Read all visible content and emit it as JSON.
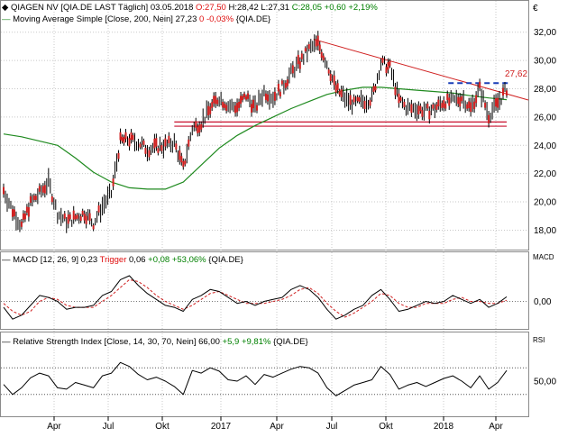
{
  "colors": {
    "price": "#000000",
    "sma": "#1f8a1f",
    "macd": "#000000",
    "trigger": "#d02020",
    "rsi": "#000000",
    "trend_red": "#d02020",
    "support_red": "#c8102e",
    "resistance_blue": "#1a3fb8",
    "grid": "#c8c8c8",
    "text_red": "#e01010",
    "text_green": "#008000",
    "annotation": "#d02020"
  },
  "chart_data": [
    {
      "type": "line",
      "panel": "price",
      "currency_symbol": "€",
      "header": {
        "name": "QIAGEN NV [QIA.DE LAST Täglich]",
        "date": "03.05.2018",
        "open": "O:27,50",
        "high": "H:28,42",
        "low": "L:27,31",
        "close": "C:28,05",
        "change": "+0,60",
        "change_pct": "+2,19%"
      },
      "sma_header": {
        "name": "Moving Average Simple [Close, 200, Nein]",
        "value": "27,23",
        "change": "0",
        "change_pct": "-0,03%",
        "symbol": "{QIA.DE}"
      },
      "annotation": "27,62",
      "ylim": [
        17.2,
        33.0
      ],
      "y_ticks": [
        "18,00",
        "20,00",
        "22,00",
        "24,00",
        "26,00",
        "28,00",
        "30,00",
        "32,00"
      ],
      "y_tick_values": [
        18,
        20,
        22,
        24,
        26,
        28,
        30,
        32
      ],
      "series": [
        {
          "name": "QIAGEN NV",
          "x": [
            0,
            10,
            20,
            30,
            40,
            50,
            60,
            70,
            80,
            90,
            100,
            110,
            120,
            130,
            140,
            150,
            160,
            170,
            180,
            190,
            200,
            210,
            220,
            230,
            240,
            250,
            260,
            270,
            280,
            290,
            300,
            310,
            320,
            330,
            340,
            350,
            360,
            370,
            380,
            390,
            400,
            410,
            420,
            430,
            440,
            450,
            460,
            470,
            480,
            490,
            500,
            510,
            520,
            530,
            540,
            550,
            560
          ],
          "values": [
            20.8,
            19.4,
            18.3,
            19.9,
            20.6,
            21.4,
            19.2,
            18.6,
            18.9,
            19.2,
            18.5,
            19.7,
            20.6,
            24.3,
            24.4,
            24.2,
            23.7,
            23.9,
            24.0,
            24.2,
            22.4,
            25.2,
            25.6,
            26.6,
            27.4,
            26.8,
            26.7,
            27.5,
            26.6,
            27.8,
            27.4,
            28.1,
            29.1,
            29.9,
            30.8,
            31.2,
            29.8,
            28.0,
            27.3,
            26.9,
            27.1,
            27.3,
            29.8,
            29.5,
            27.2,
            26.6,
            26.6,
            26.4,
            26.6,
            27.1,
            27.1,
            27.4,
            26.6,
            28.0,
            26.1,
            27.0,
            28.0
          ]
        },
        {
          "name": "Moving Average Simple",
          "x": [
            0,
            20,
            40,
            60,
            80,
            100,
            120,
            140,
            160,
            180,
            200,
            220,
            240,
            260,
            280,
            300,
            320,
            340,
            360,
            380,
            400,
            420,
            440,
            460,
            480,
            500,
            520,
            540,
            560
          ],
          "values": [
            24.8,
            24.6,
            24.3,
            24.0,
            23.1,
            22.1,
            21.4,
            21.0,
            20.9,
            20.9,
            21.4,
            22.6,
            23.8,
            24.7,
            25.4,
            26.0,
            26.6,
            27.1,
            27.6,
            27.9,
            28.1,
            28.1,
            28.0,
            27.9,
            27.8,
            27.7,
            27.5,
            27.35,
            27.23
          ]
        }
      ]
    },
    {
      "type": "line",
      "panel": "macd",
      "header": {
        "name": "MACD [12, 26, 9]",
        "value": "0,23",
        "trigger_label": "Trigger",
        "trigger_value": "0,06",
        "change": "+0,08",
        "change_pct": "+53,06%",
        "symbol": "{QIA.DE}"
      },
      "axis_label": "MACD",
      "y_ticks": [
        "0,00"
      ],
      "ylim": [
        -1.3,
        1.8
      ],
      "series": [
        {
          "name": "MACD",
          "x": [
            0,
            10,
            20,
            30,
            40,
            50,
            60,
            70,
            80,
            90,
            100,
            110,
            120,
            130,
            140,
            150,
            160,
            170,
            180,
            190,
            200,
            210,
            220,
            230,
            240,
            250,
            260,
            270,
            280,
            290,
            300,
            310,
            320,
            330,
            340,
            350,
            360,
            370,
            380,
            390,
            400,
            410,
            420,
            430,
            440,
            450,
            460,
            470,
            480,
            490,
            500,
            510,
            520,
            530,
            540,
            550,
            560
          ],
          "values": [
            -0.3,
            -0.9,
            -0.7,
            -0.2,
            0.3,
            0.2,
            0.0,
            -0.4,
            -0.3,
            -0.3,
            -0.2,
            0.3,
            0.5,
            1.1,
            1.3,
            0.8,
            0.4,
            0.1,
            -0.2,
            -0.3,
            -0.5,
            0.1,
            0.3,
            0.6,
            0.5,
            0.2,
            -0.1,
            0.0,
            -0.2,
            0.0,
            0.1,
            0.2,
            0.6,
            0.8,
            0.6,
            0.2,
            -0.4,
            -0.9,
            -0.7,
            -0.4,
            -0.2,
            0.3,
            0.6,
            0.1,
            -0.5,
            -0.4,
            -0.2,
            0.0,
            -0.1,
            0.0,
            0.3,
            0.1,
            -0.1,
            0.1,
            -0.3,
            -0.1,
            0.23
          ]
        },
        {
          "name": "Trigger",
          "x": [
            0,
            10,
            20,
            30,
            40,
            50,
            60,
            70,
            80,
            90,
            100,
            110,
            120,
            130,
            140,
            150,
            160,
            170,
            180,
            190,
            200,
            210,
            220,
            230,
            240,
            250,
            260,
            270,
            280,
            290,
            300,
            310,
            320,
            330,
            340,
            350,
            360,
            370,
            380,
            390,
            400,
            410,
            420,
            430,
            440,
            450,
            460,
            470,
            480,
            490,
            500,
            510,
            520,
            530,
            540,
            550,
            560
          ],
          "values": [
            -0.1,
            -0.5,
            -0.7,
            -0.5,
            0.0,
            0.2,
            0.1,
            -0.2,
            -0.3,
            -0.3,
            -0.3,
            0.0,
            0.3,
            0.7,
            1.1,
            1.0,
            0.7,
            0.3,
            0.0,
            -0.2,
            -0.4,
            -0.2,
            0.1,
            0.4,
            0.5,
            0.3,
            0.1,
            -0.1,
            -0.1,
            -0.1,
            0.0,
            0.1,
            0.3,
            0.6,
            0.7,
            0.4,
            -0.1,
            -0.5,
            -0.8,
            -0.6,
            -0.3,
            0.0,
            0.4,
            0.3,
            -0.1,
            -0.3,
            -0.3,
            -0.1,
            -0.1,
            -0.1,
            0.1,
            0.2,
            0.0,
            0.0,
            -0.1,
            -0.1,
            0.06
          ]
        }
      ]
    },
    {
      "type": "line",
      "panel": "rsi",
      "header": {
        "name": "Relative Strength Index [Close, 14, 30, 70, Nein]",
        "value": "66,00",
        "change": "+5,9",
        "change_pct": "+9,81%",
        "symbol": "{QIA.DE}"
      },
      "axis_label": "RSI",
      "y_ticks": [
        "50,00"
      ],
      "ylim": [
        0,
        100
      ],
      "reference_lines": [
        30,
        70
      ],
      "series": [
        {
          "name": "Relative Strength Index",
          "x": [
            0,
            10,
            20,
            30,
            40,
            50,
            60,
            70,
            80,
            90,
            100,
            110,
            120,
            130,
            140,
            150,
            160,
            170,
            180,
            190,
            200,
            210,
            220,
            230,
            240,
            250,
            260,
            270,
            280,
            290,
            300,
            310,
            320,
            330,
            340,
            350,
            360,
            370,
            380,
            390,
            400,
            410,
            420,
            430,
            440,
            450,
            460,
            470,
            480,
            490,
            500,
            510,
            520,
            530,
            540,
            550,
            560
          ],
          "values": [
            45,
            30,
            40,
            55,
            62,
            58,
            40,
            38,
            48,
            44,
            40,
            58,
            62,
            78,
            72,
            60,
            52,
            56,
            50,
            42,
            30,
            66,
            62,
            70,
            65,
            52,
            50,
            58,
            45,
            60,
            56,
            62,
            68,
            72,
            70,
            62,
            40,
            28,
            36,
            44,
            48,
            52,
            72,
            60,
            38,
            44,
            48,
            42,
            48,
            54,
            58,
            50,
            40,
            58,
            38,
            48,
            66
          ]
        }
      ]
    }
  ],
  "x_axis": {
    "labels": [
      "Apr",
      "Jul",
      "Okt",
      "2017",
      "Apr",
      "Jul",
      "Okt",
      "2018",
      "Apr"
    ],
    "positions": [
      60,
      120,
      180,
      245,
      307,
      368,
      428,
      492,
      550
    ]
  }
}
